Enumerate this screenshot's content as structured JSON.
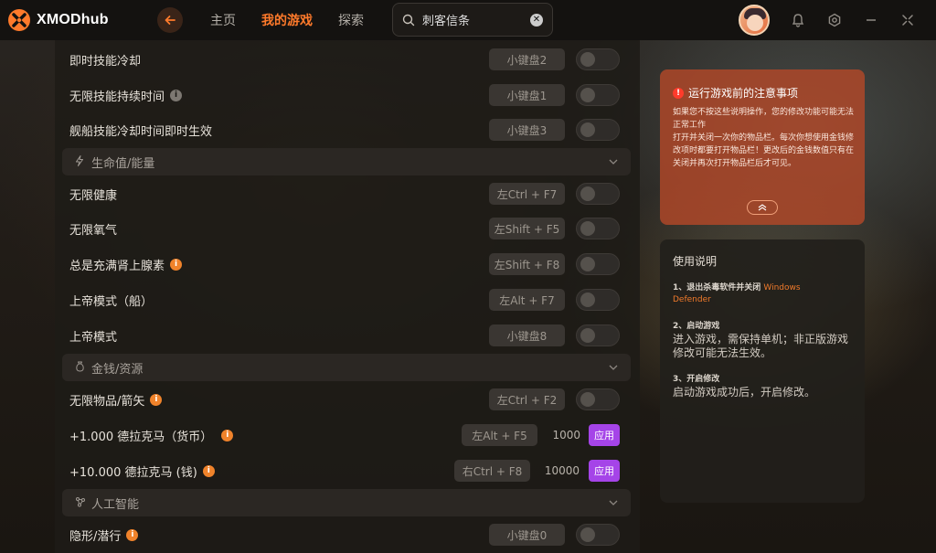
{
  "app": {
    "name": "XMODhub"
  },
  "nav": {
    "home": "主页",
    "my_games": "我的游戏",
    "explore": "探索"
  },
  "search": {
    "value": "刺客信条"
  },
  "icons": {
    "logo": "xmodhub-logo-icon",
    "back": "arrow-left-icon",
    "search": "search-icon",
    "clear": "clear-icon",
    "bell": "notification-icon",
    "settings": "settings-icon",
    "minimize": "minimize-icon",
    "fullscreen": "fullscreen-icon"
  },
  "colors": {
    "accent": "#ff7a2b",
    "apply": "#a544e8",
    "notice": "#b24828"
  },
  "rows": [
    {
      "label": "即时技能冷却",
      "key": "小键盘2",
      "info": ""
    },
    {
      "label": "无限技能持续时间",
      "key": "小键盘1",
      "info": "gray"
    },
    {
      "label": "舰船技能冷却时间即时生效",
      "key": "小键盘3",
      "info": ""
    }
  ],
  "sections": {
    "health": {
      "label": "生命值/能量"
    },
    "money": {
      "label": "金钱/资源"
    },
    "ai": {
      "label": "人工智能"
    }
  },
  "health_rows": [
    {
      "label": "无限健康",
      "key": "左Ctrl + F7"
    },
    {
      "label": "无限氧气",
      "key": "左Shift + F5"
    },
    {
      "label": "总是充满肾上腺素",
      "key": "左Shift + F8"
    },
    {
      "label": "上帝模式（船）",
      "key": "左Alt + F7"
    },
    {
      "label": "上帝模式",
      "key": "小键盘8"
    }
  ],
  "money_rows": [
    {
      "label": "无限物品/箭矢",
      "key": "左Ctrl + F2"
    },
    {
      "label": "+1.000 德拉克马（货币）",
      "key": "左Alt + F5",
      "value": "1000",
      "apply": "应用"
    },
    {
      "label": "+10.000 德拉克马 (钱)",
      "key": "右Ctrl + F8",
      "value": "10000",
      "apply": "应用"
    }
  ],
  "ai_rows": [
    {
      "label": "隐形/潜行",
      "key": "小键盘0"
    }
  ],
  "notice": {
    "title": "运行游戏前的注意事项",
    "line1": "如果您不按这些说明操作，您的修改功能可能无法正常工作",
    "line2": "打开并关闭一次你的物品栏。每次你想使用金钱修改项时都要打开物品栏！更改后的金钱数值只有在关闭并再次打开物品栏后才可见。"
  },
  "usage": {
    "title": "使用说明",
    "step1_head": "1、退出杀毒软件并关闭",
    "step1_hl1": "Windows",
    "step1_hl2": "Defender",
    "step2_head": "2、启动游戏",
    "step2_text": "进入游戏，需保持单机；非正版游戏修改可能无法生效。",
    "step3_head": "3、开启修改",
    "step3_text": "启动游戏成功后，开启修改。"
  }
}
